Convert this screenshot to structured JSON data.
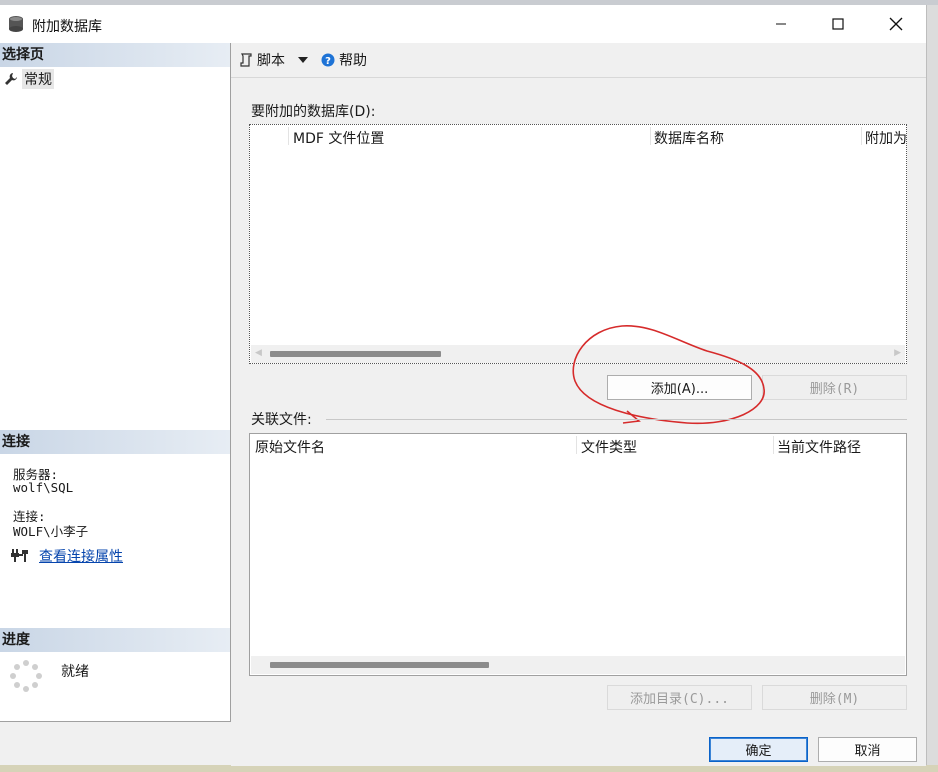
{
  "window": {
    "title": "附加数据库",
    "minimize_label": "—",
    "maximize_label": "☐",
    "close_label": "✕"
  },
  "left": {
    "select_page_header": "选择页",
    "nav_items": [
      {
        "label": "常规",
        "icon": "wrench-icon"
      }
    ],
    "connection_header": "连接",
    "server_label": "服务器:",
    "server_value": "wolf\\SQL",
    "connection_label": "连接:",
    "connection_value": "WOLF\\小李子",
    "view_props_link": "查看连接属性",
    "progress_header": "进度",
    "progress_status": "就绪"
  },
  "toolbar": {
    "script_label": "脚本",
    "help_label": "帮助"
  },
  "attach": {
    "label": "要附加的数据库(D):",
    "columns": [
      "MDF 文件位置",
      "数据库名称",
      "附加为"
    ],
    "rows": [],
    "add_button": "添加(A)...",
    "remove_button": "删除(R)"
  },
  "related": {
    "label": "关联文件:",
    "columns": [
      "原始文件名",
      "文件类型",
      "当前文件路径"
    ],
    "rows": [],
    "add_dir_button": "添加目录(C)...",
    "remove_button": "删除(M)"
  },
  "footer": {
    "ok_button": "确定",
    "cancel_button": "取消"
  },
  "colors": {
    "annotation_circle": "#d62b2b",
    "link": "#0645ad",
    "section_header": "#c9d6e6"
  }
}
